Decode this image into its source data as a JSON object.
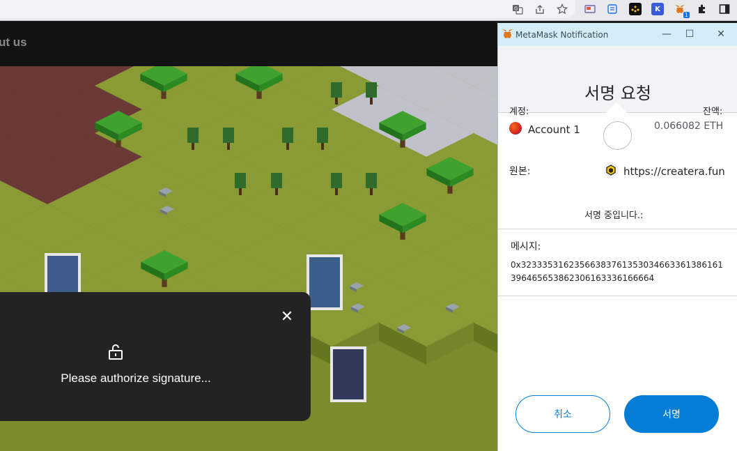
{
  "site": {
    "nav_link": "ut us",
    "modal": {
      "close_glyph": "✕",
      "message": "Please authorize signature..."
    }
  },
  "metamask": {
    "window_title": "MetaMask Notification",
    "heading": "서명 요청",
    "account_label": "계정:",
    "account_name": "Account 1",
    "balance_label": "잔액:",
    "balance_value": "0.066082 ETH",
    "origin_label": "원본:",
    "origin_url": "https://createra.fun",
    "signing_status": "서명 중입니다.:",
    "message_label": "메시지:",
    "message_hex": "0x32333531623566383761353034663361386161396465653862306163336166664",
    "cancel_button": "취소",
    "sign_button": "서명"
  },
  "browser": {
    "extension_badge": "1"
  },
  "colors": {
    "accent": "#037dd6",
    "titlebar": "#d3eef8",
    "modal_bg": "#232323"
  }
}
